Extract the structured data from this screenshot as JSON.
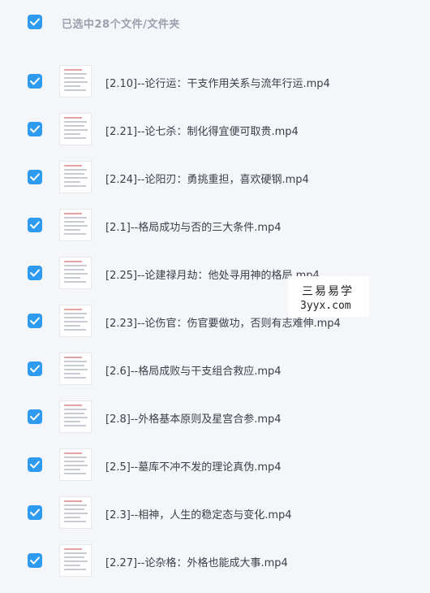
{
  "header": {
    "title": "已选中28个文件/文件夹"
  },
  "files": [
    {
      "name": "[2.10]--论行运：干支作用关系与流年行运.mp4"
    },
    {
      "name": "[2.21]--论七杀：制化得宜便可取贵.mp4"
    },
    {
      "name": "[2.24]--论阳刃：勇挑重担，喜欢硬钢.mp4"
    },
    {
      "name": "[2.1]--格局成功与否的三大条件.mp4"
    },
    {
      "name": "[2.25]--论建禄月劫：他处寻用神的格局.mp4"
    },
    {
      "name": "[2.23]--论伤官：伤官要做功，否则有志难伸.mp4"
    },
    {
      "name": "[2.6]--格局成败与干支组合救应.mp4"
    },
    {
      "name": "[2.8]--外格基本原则及星宫合参.mp4"
    },
    {
      "name": "[2.5]--墓库不冲不发的理论真伪.mp4"
    },
    {
      "name": "[2.3]--相神，人生的稳定态与变化.mp4"
    },
    {
      "name": "[2.27]--论杂格：外格也能成大事.mp4"
    }
  ],
  "watermark": {
    "line1": "三易易学",
    "line2": "3yyx.com"
  },
  "colors": {
    "checkbox": "#2f9bf0",
    "background": "#f4f6fa",
    "text": "#3b3f46",
    "header_text": "#9aa0ab"
  },
  "icons": {
    "checkbox": "check-icon",
    "thumbnail": "video-thumbnail"
  }
}
